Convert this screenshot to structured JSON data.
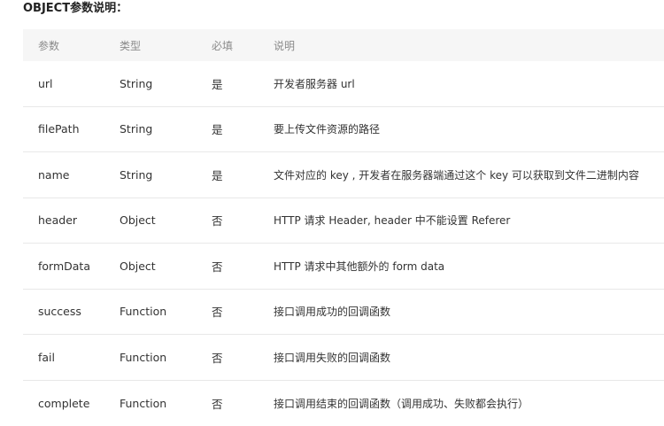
{
  "heading": "OBJECT参数说明：",
  "table": {
    "columns": [
      "参数",
      "类型",
      "必填",
      "说明"
    ],
    "rows": [
      {
        "name": "url",
        "type": "String",
        "required": "是",
        "description": "开发者服务器 url"
      },
      {
        "name": "filePath",
        "type": "String",
        "required": "是",
        "description": "要上传文件资源的路径"
      },
      {
        "name": "name",
        "type": "String",
        "required": "是",
        "description": "文件对应的 key , 开发者在服务器端通过这个 key 可以获取到文件二进制内容"
      },
      {
        "name": "header",
        "type": "Object",
        "required": "否",
        "description": "HTTP 请求 Header, header 中不能设置 Referer"
      },
      {
        "name": "formData",
        "type": "Object",
        "required": "否",
        "description": "HTTP 请求中其他额外的 form data"
      },
      {
        "name": "success",
        "type": "Function",
        "required": "否",
        "description": "接口调用成功的回调函数"
      },
      {
        "name": "fail",
        "type": "Function",
        "required": "否",
        "description": "接口调用失败的回调函数"
      },
      {
        "name": "complete",
        "type": "Function",
        "required": "否",
        "description": "接口调用结束的回调函数（调用成功、失败都会执行）"
      }
    ]
  }
}
